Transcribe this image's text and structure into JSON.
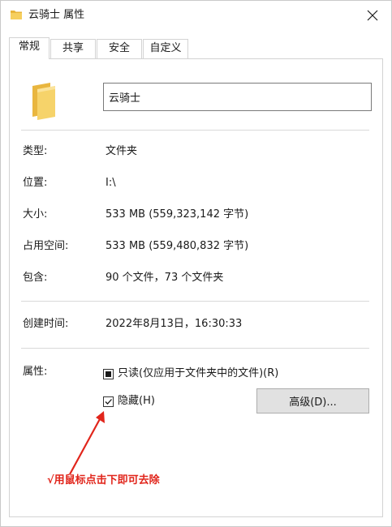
{
  "window": {
    "title": "云骑士 属性",
    "close_icon": "close-icon"
  },
  "tabs": [
    {
      "label": "常规",
      "active": true
    },
    {
      "label": "共享",
      "active": false
    },
    {
      "label": "安全",
      "active": false
    },
    {
      "label": "自定义",
      "active": false
    }
  ],
  "general": {
    "folder_name": "云骑士",
    "rows": [
      {
        "label": "类型:",
        "value": "文件夹"
      },
      {
        "label": "位置:",
        "value": "I:\\"
      },
      {
        "label": "大小:",
        "value": "533 MB (559,323,142 字节)"
      },
      {
        "label": "占用空间:",
        "value": "533 MB (559,480,832 字节)"
      },
      {
        "label": "包含:",
        "value": "90 个文件，73 个文件夹"
      },
      {
        "label": "创建时间:",
        "value": "2022年8月13日，16:30:33"
      }
    ],
    "attributes": {
      "label": "属性:",
      "readonly": {
        "label": "只读(仅应用于文件夹中的文件)(R)",
        "state": "indeterminate"
      },
      "hidden": {
        "label": "隐藏(H)",
        "state": "checked"
      },
      "advanced_button": "高级(D)..."
    }
  },
  "annotation": {
    "text": "√用鼠标点击下即可去除",
    "color": "#e1251b"
  },
  "colors": {
    "folder": "#f2c84b",
    "annotation": "#e1251b",
    "button_bg": "#e1e1e1"
  }
}
